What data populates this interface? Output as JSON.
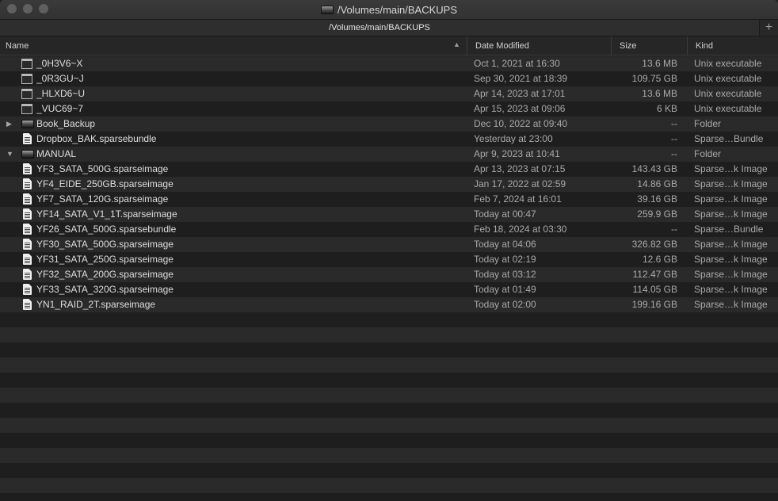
{
  "window": {
    "title": "/Volumes/main/BACKUPS"
  },
  "tab": {
    "label": "/Volumes/main/BACKUPS",
    "new_tab_symbol": "+"
  },
  "columns": {
    "name": "Name",
    "date": "Date Modified",
    "size": "Size",
    "kind": "Kind"
  },
  "sort": {
    "column": "Name",
    "direction": "ascending",
    "symbol": "^"
  },
  "colors": {
    "background": "#1e1e1e",
    "alt_row": "#2a2a2a",
    "text": "#dedede",
    "secondary_text": "#a9a9a9"
  },
  "rows": [
    {
      "disclosure": "",
      "icon": "executable-icon",
      "name": "_0H3V6~X",
      "date": "Oct 1, 2021 at 16:30",
      "size": "13.6 MB",
      "kind": "Unix executable"
    },
    {
      "disclosure": "",
      "icon": "executable-icon",
      "name": "_0R3GU~J",
      "date": "Sep 30, 2021 at 18:39",
      "size": "109.75 GB",
      "kind": "Unix executable"
    },
    {
      "disclosure": "",
      "icon": "executable-icon",
      "name": "_HLXD6~U",
      "date": "Apr 14, 2023 at 17:01",
      "size": "13.6 MB",
      "kind": "Unix executable"
    },
    {
      "disclosure": "",
      "icon": "executable-icon",
      "name": "_VUC69~7",
      "date": "Apr 15, 2023 at 09:06",
      "size": "6 KB",
      "kind": "Unix executable"
    },
    {
      "disclosure": "▶",
      "icon": "folder-icon",
      "name": "Book_Backup",
      "date": "Dec 10, 2022 at 09:40",
      "size": "--",
      "kind": "Folder"
    },
    {
      "disclosure": "",
      "icon": "document-icon",
      "name": "Dropbox_BAK.sparsebundle",
      "date": "Yesterday at 23:00",
      "size": "--",
      "kind": "Sparse…Bundle"
    },
    {
      "disclosure": "▼",
      "icon": "folder-icon",
      "name": "MANUAL",
      "date": "Apr 9, 2023 at 10:41",
      "size": "--",
      "kind": "Folder"
    },
    {
      "disclosure": "",
      "icon": "document-icon",
      "name": "YF3_SATA_500G.sparseimage",
      "date": "Apr 13, 2023 at 07:15",
      "size": "143.43 GB",
      "kind": "Sparse…k Image"
    },
    {
      "disclosure": "",
      "icon": "document-icon",
      "name": "YF4_EIDE_250GB.sparseimage",
      "date": "Jan 17, 2022 at 02:59",
      "size": "14.86 GB",
      "kind": "Sparse…k Image"
    },
    {
      "disclosure": "",
      "icon": "document-icon",
      "name": "YF7_SATA_120G.sparseimage",
      "date": "Feb 7, 2024 at 16:01",
      "size": "39.16 GB",
      "kind": "Sparse…k Image"
    },
    {
      "disclosure": "",
      "icon": "document-icon",
      "name": "YF14_SATA_V1_1T.sparseimage",
      "date": "Today at 00:47",
      "size": "259.9 GB",
      "kind": "Sparse…k Image"
    },
    {
      "disclosure": "",
      "icon": "document-icon",
      "name": "YF26_SATA_500G.sparsebundle",
      "date": "Feb 18, 2024 at 03:30",
      "size": "--",
      "kind": "Sparse…Bundle"
    },
    {
      "disclosure": "",
      "icon": "document-icon",
      "name": "YF30_SATA_500G.sparseimage",
      "date": "Today at 04:06",
      "size": "326.82 GB",
      "kind": "Sparse…k Image"
    },
    {
      "disclosure": "",
      "icon": "document-icon",
      "name": "YF31_SATA_250G.sparseimage",
      "date": "Today at 02:19",
      "size": "12.6 GB",
      "kind": "Sparse…k Image"
    },
    {
      "disclosure": "",
      "icon": "document-icon",
      "name": "YF32_SATA_200G.sparseimage",
      "date": "Today at 03:12",
      "size": "112.47 GB",
      "kind": "Sparse…k Image"
    },
    {
      "disclosure": "",
      "icon": "document-icon",
      "name": "YF33_SATA_320G.sparseimage",
      "date": "Today at 01:49",
      "size": "114.05 GB",
      "kind": "Sparse…k Image"
    },
    {
      "disclosure": "",
      "icon": "document-icon",
      "name": "YN1_RAID_2T.sparseimage",
      "date": "Today at 02:00",
      "size": "199.16 GB",
      "kind": "Sparse…k Image"
    }
  ]
}
